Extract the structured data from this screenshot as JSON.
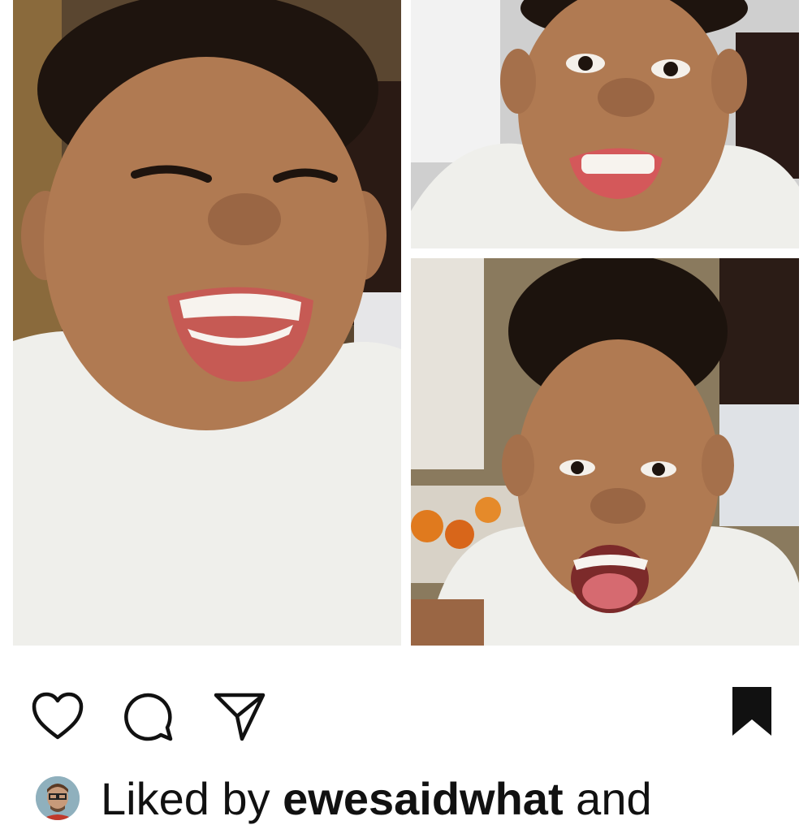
{
  "post": {
    "photos": [
      {
        "subject": "smiling child photo"
      },
      {
        "subject": "grimacing child photo"
      },
      {
        "subject": "shouting child photo"
      }
    ]
  },
  "actions": {
    "like_icon": "heart-icon",
    "comment_icon": "comment-bubble-icon",
    "share_icon": "paper-plane-icon",
    "save_icon": "bookmark-icon"
  },
  "likes": {
    "prefix": "Liked by",
    "user": "ewesaidwhat",
    "suffix": "and"
  },
  "colors": {
    "icon": "#111111",
    "text": "#111111",
    "background": "#ffffff"
  }
}
